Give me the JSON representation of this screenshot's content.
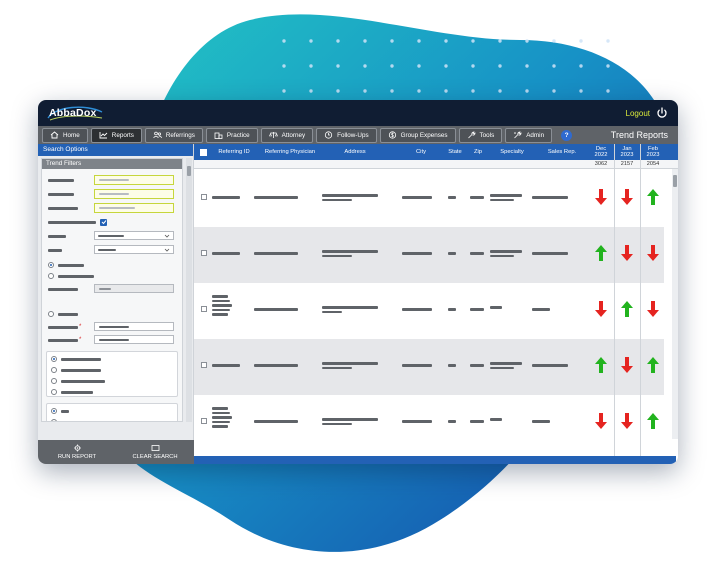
{
  "app": {
    "logo_text": "AbbaDox",
    "logout_label": "Logout"
  },
  "nav": {
    "items": [
      {
        "label": "Home",
        "icon": "home-icon"
      },
      {
        "label": "Reports",
        "icon": "chart-icon"
      },
      {
        "label": "Referrings",
        "icon": "users-icon"
      },
      {
        "label": "Practice",
        "icon": "building-icon"
      },
      {
        "label": "Attorney",
        "icon": "scales-icon"
      },
      {
        "label": "Follow-Ups",
        "icon": "clock-icon"
      },
      {
        "label": "Group Expenses",
        "icon": "dollar-icon"
      },
      {
        "label": "Tools",
        "icon": "wrench-icon"
      },
      {
        "label": "Admin",
        "icon": "admin-icon"
      }
    ],
    "active": "Reports",
    "help_label": "?",
    "page_title": "Trend Reports"
  },
  "sidebar": {
    "header": "Search Options",
    "filters_title": "Trend Filters",
    "footer": {
      "run_label": "RUN REPORT",
      "clear_label": "CLEAR SEARCH"
    }
  },
  "table": {
    "headers": {
      "referring_id": "Referring ID",
      "physician": "Referring Physician",
      "address": "Address",
      "city": "City",
      "state": "State",
      "zip": "Zip",
      "specialty": "Specialty",
      "sales_rep": "Sales Rep."
    },
    "months": [
      {
        "month": "Dec",
        "year": "2022",
        "total": "3062"
      },
      {
        "month": "Jan",
        "year": "2023",
        "total": "2157"
      },
      {
        "month": "Feb",
        "year": "2023",
        "total": "2054"
      }
    ],
    "rows": [
      {
        "trend": [
          "down",
          "down",
          "up"
        ]
      },
      {
        "trend": [
          "up",
          "down",
          "down"
        ]
      },
      {
        "trend": [
          "down",
          "up",
          "down"
        ]
      },
      {
        "trend": [
          "up",
          "down",
          "up"
        ]
      },
      {
        "trend": [
          "down",
          "down",
          "up"
        ]
      }
    ]
  },
  "colors": {
    "up": "#22b31e",
    "down": "#e52420",
    "accent_blue": "#2361b5",
    "highlight": "#d8e83a"
  }
}
